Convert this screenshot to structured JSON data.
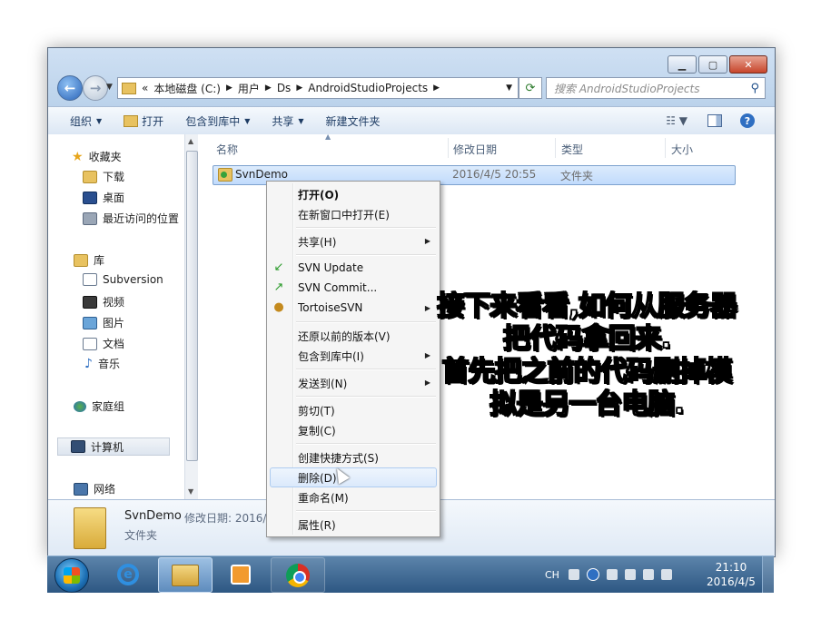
{
  "address": {
    "path": [
      "«",
      "本地磁盘 (C:)",
      "用户",
      "Ds",
      "AndroidStudioProjects"
    ],
    "search_placeholder": "搜索 AndroidStudioProjects"
  },
  "toolbar": {
    "organize": "组织",
    "open": "打开",
    "include_library": "包含到库中",
    "share": "共享",
    "new_folder": "新建文件夹"
  },
  "nav": {
    "favorites": "收藏夹",
    "downloads": "下载",
    "desktop": "桌面",
    "recent": "最近访问的位置",
    "libraries": "库",
    "subversion": "Subversion",
    "videos": "视频",
    "pictures": "图片",
    "documents": "文档",
    "music": "音乐",
    "homegroup": "家庭组",
    "computer": "计算机",
    "network": "网络"
  },
  "columns": {
    "name": "名称",
    "modified": "修改日期",
    "type": "类型",
    "size": "大小"
  },
  "files": [
    {
      "name": "SvnDemo",
      "modified": "2016/4/5 20:55",
      "type": "文件夹"
    }
  ],
  "details": {
    "name": "SvnDemo",
    "meta": "修改日期: 2016/",
    "type": "文件夹"
  },
  "context_menu": {
    "open": "打开(O)",
    "open_new_window": "在新窗口中打开(E)",
    "share": "共享(H)",
    "svn_update": "SVN Update",
    "svn_commit": "SVN Commit...",
    "tortoise": "TortoiseSVN",
    "restore": "还原以前的版本(V)",
    "include_library": "包含到库中(I)",
    "send_to": "发送到(N)",
    "cut": "剪切(T)",
    "copy": "复制(C)",
    "create_shortcut": "创建快捷方式(S)",
    "delete": "删除(D)",
    "rename": "重命名(M)",
    "properties": "属性(R)"
  },
  "overlay_caption": [
    "接下来看看,如何从服务器",
    "把代码拿回来.",
    "首先把之前的代码删掉模",
    "拟是另一台电脑."
  ],
  "taskbar": {
    "lang": "CH",
    "time": "21:10",
    "date": "2016/4/5"
  }
}
